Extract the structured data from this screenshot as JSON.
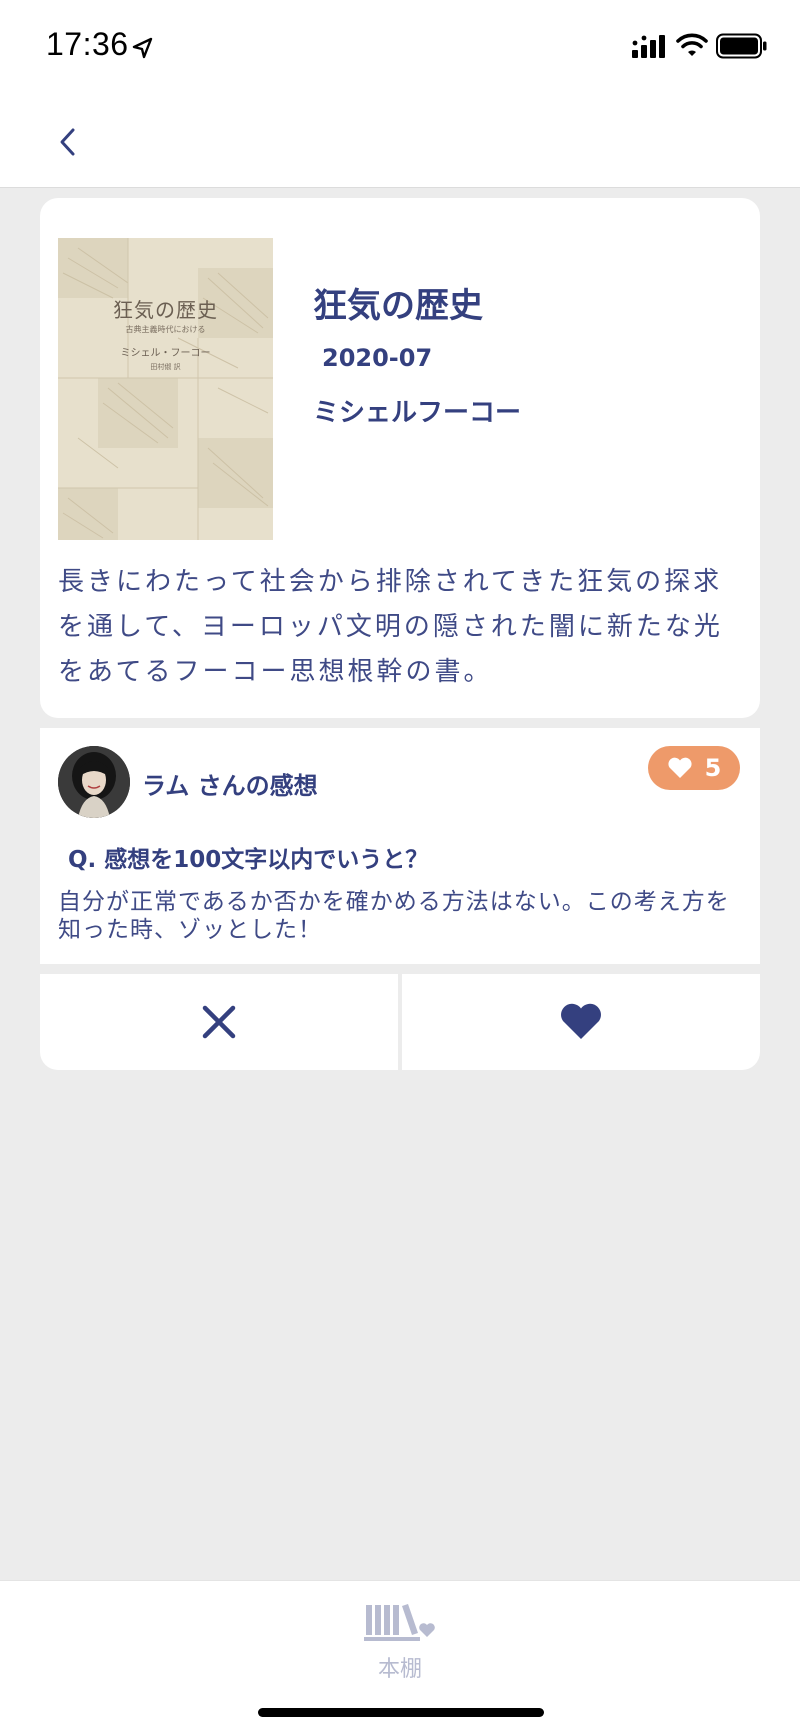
{
  "status_bar": {
    "time": "17:36",
    "icons": [
      "location-arrow-icon",
      "signal-icon",
      "wifi-icon",
      "battery-icon"
    ]
  },
  "nav": {
    "back_icon": "chevron-left-icon"
  },
  "book": {
    "cover_text": {
      "title": "狂気の歴史",
      "subtitle": "古典主義時代における",
      "author": "ミシェル・フーコー",
      "translator": "田村俶 訳"
    },
    "title": "狂気の歴史",
    "date": "2020-07",
    "author": "ミシェルフーコー",
    "description": "長きにわたって社会から排除されてきた狂気の探求を通して、ヨーロッパ文明の隠された闇に新たな光をあてるフーコー思想根幹の書。"
  },
  "review": {
    "reviewer": "ラム さんの感想",
    "likes": "5",
    "question": "Q. 感想を100文字以内でいうと？",
    "answer": "自分が正常であるか否かを確かめる方法はない。この考え方を知った時、ゾッとした！"
  },
  "actions": {
    "dislike_icon": "close-icon",
    "like_icon": "heart-icon"
  },
  "tab_bar": {
    "items": [
      {
        "label": "本棚",
        "icon": "bookshelf-icon"
      }
    ]
  },
  "colors": {
    "primary": "#34407f",
    "accent": "#ee9a6a",
    "background": "#ececec",
    "tab_inactive": "#b7bbd0"
  }
}
